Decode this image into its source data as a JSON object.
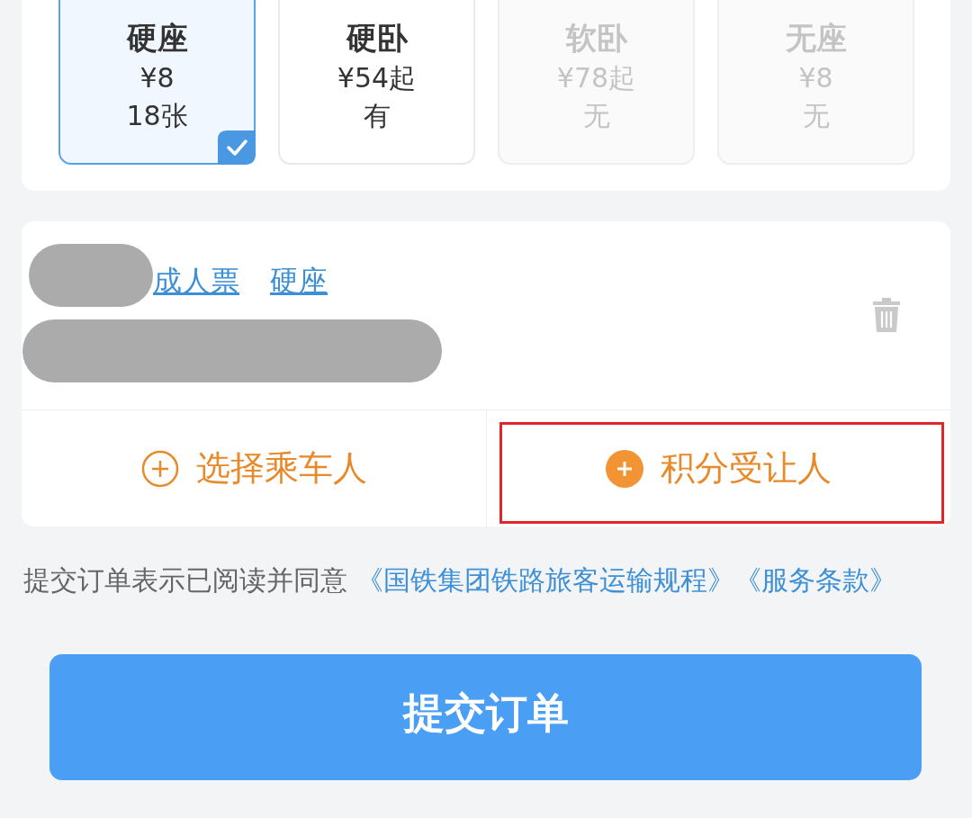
{
  "seats": [
    {
      "name": "硬座",
      "price": "¥8",
      "availability": "18张",
      "selected": true,
      "disabled": false
    },
    {
      "name": "硬卧",
      "price": "¥54起",
      "availability": "有",
      "selected": false,
      "disabled": false
    },
    {
      "name": "软卧",
      "price": "¥78起",
      "availability": "无",
      "selected": false,
      "disabled": true
    },
    {
      "name": "无座",
      "price": "¥8",
      "availability": "无",
      "selected": false,
      "disabled": true
    }
  ],
  "passenger": {
    "ticket_type": "成人票",
    "seat": "硬座"
  },
  "actions": [
    {
      "label": "选择乘车人",
      "kind": "outline",
      "highlighted": false
    },
    {
      "label": "积分受让人",
      "kind": "filled",
      "highlighted": true
    }
  ],
  "agreement": {
    "text": "提交订单表示已阅读并同意",
    "links": [
      "《国铁集团铁路旅客运输规程》",
      "《服务条款》"
    ]
  },
  "submit": "提交订单"
}
